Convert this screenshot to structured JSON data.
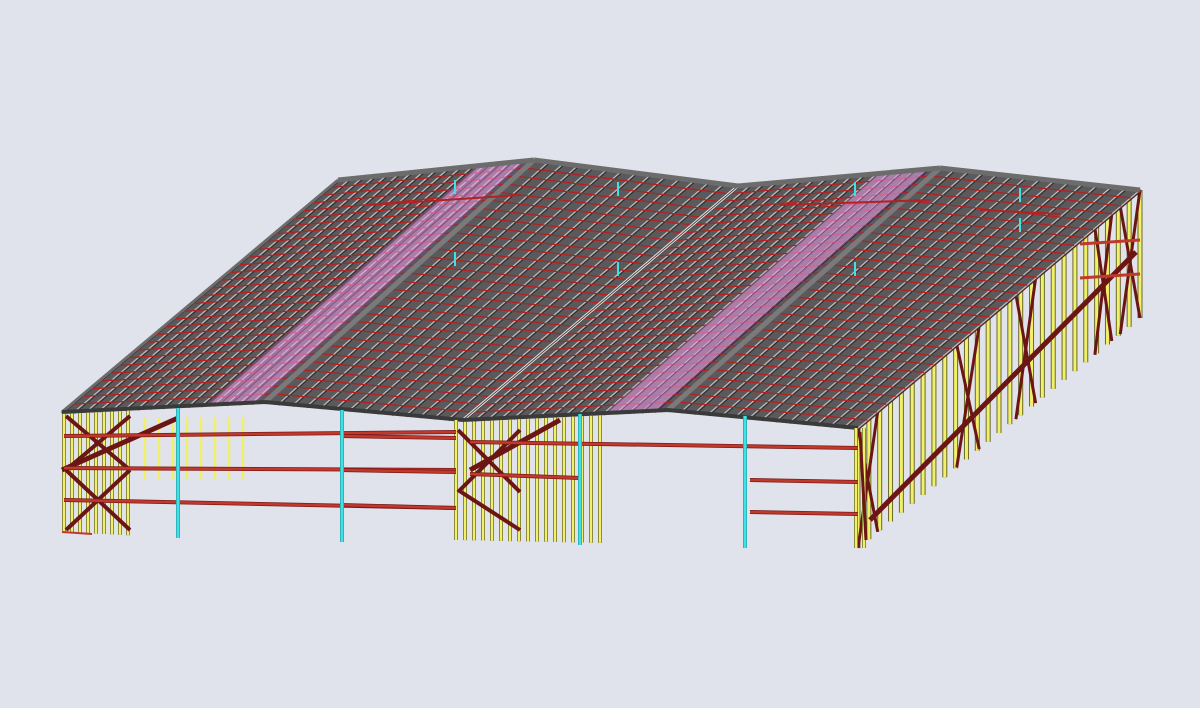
{
  "view": {
    "background": "#e0e2ec"
  },
  "model": {
    "type": "3d-steel-frame",
    "buildings": 2,
    "roof_form": "twin-gable",
    "colors": {
      "roof_panel": "#5a5a5c",
      "roof_ridge": "#7a7a7c",
      "purlin": "#b22222",
      "skylight": "#e8a0e8",
      "column": "#f2f06a",
      "column_edge": "#6a6a2a",
      "bracing": "#6b1515",
      "girt": "#c0392b",
      "door_jamb": "#40e0e8"
    },
    "icons": [
      "roof-grid",
      "wall-columns",
      "x-bracing",
      "door-jambs"
    ]
  }
}
